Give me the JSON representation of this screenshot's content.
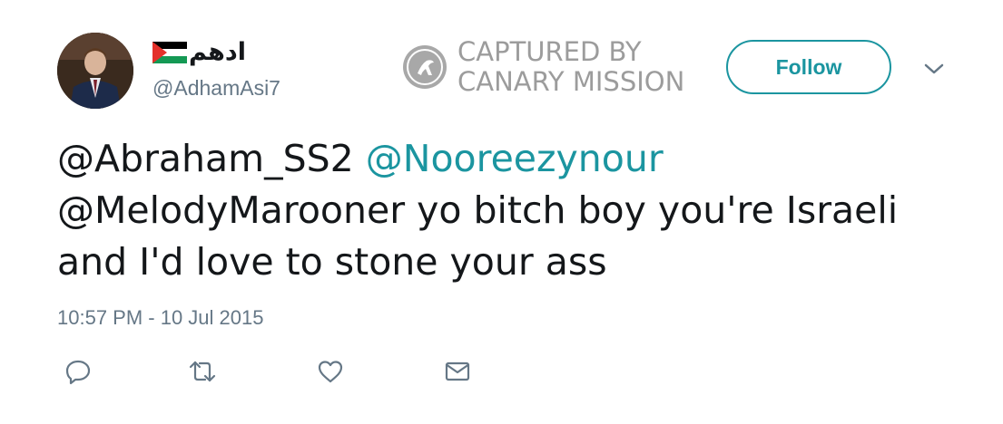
{
  "tweet": {
    "display_name": "ادهم",
    "flag_icon": "palestine-flag-icon",
    "handle": "@AdhamAsi7",
    "text_plain_1": "@Abraham_SS2 ",
    "text_link": "@Nooreezynour",
    "text_plain_2": "@MelodyMarooner yo bitch boy you're Israeli",
    "text_plain_3": "and I'd love to stone your ass",
    "timestamp": "10:57 PM - 10 Jul 2015"
  },
  "watermark": {
    "line1": "CAPTURED BY",
    "line2": "CANARY MISSION",
    "logo_icon": "canary-mission-logo"
  },
  "follow_button": {
    "label": "Follow"
  },
  "actions": {
    "reply_icon": "reply-icon",
    "retweet_icon": "retweet-icon",
    "like_icon": "heart-icon",
    "message_icon": "envelope-icon"
  },
  "colors": {
    "accent": "#1b95a0",
    "secondary_text": "#657786",
    "primary_text": "#14171a",
    "watermark": "#9c9c9c"
  }
}
